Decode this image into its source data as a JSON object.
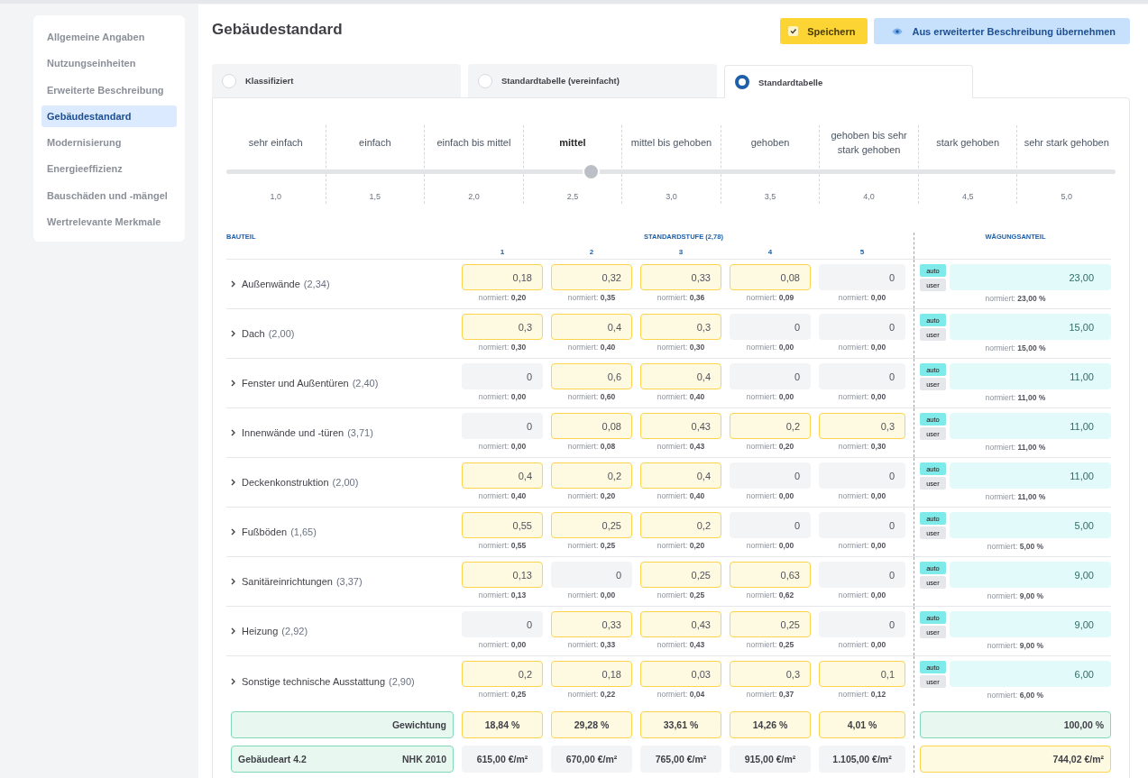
{
  "sidebar": {
    "items": [
      {
        "label": "Allgemeine Angaben",
        "selected": false
      },
      {
        "label": "Nutzungseinheiten",
        "selected": false
      },
      {
        "label": "Erweiterte Beschreibung",
        "selected": false
      },
      {
        "label": "Gebäudestandard",
        "selected": true
      },
      {
        "label": "Modernisierung",
        "selected": false
      },
      {
        "label": "Energieeffizienz",
        "selected": false
      },
      {
        "label": "Bauschäden und -mängel",
        "selected": false
      },
      {
        "label": "Wertrelevante Merkmale",
        "selected": false
      }
    ]
  },
  "title": "Gebäudestandard",
  "buttons": [
    {
      "kind": "save",
      "label": "Speichern"
    },
    {
      "kind": "import",
      "label": "Aus erweiterter Beschreibung übernehmen"
    }
  ],
  "tabs": [
    {
      "label": "Klassifiziert",
      "selected": false
    },
    {
      "label": "Standardtabelle (vereinfacht)",
      "selected": false
    },
    {
      "label": "Standardtabelle",
      "selected": true
    }
  ],
  "scale": {
    "level": 0.41,
    "steps": [
      {
        "label": "sehr einfach",
        "value": "1,0",
        "selected": false
      },
      {
        "label": "einfach",
        "value": "1,5",
        "selected": false
      },
      {
        "label": "einfach bis mittel",
        "value": "2,0",
        "selected": false
      },
      {
        "label": "mittel",
        "value": "2,5",
        "selected": true
      },
      {
        "label": "mittel bis gehoben",
        "value": "3,0",
        "selected": false
      },
      {
        "label": "gehoben",
        "value": "3,5",
        "selected": false
      },
      {
        "label": "gehoben bis sehr stark gehoben",
        "value": "4,0",
        "selected": false
      },
      {
        "label": "stark gehoben",
        "value": "4,5",
        "selected": false
      },
      {
        "label": "sehr stark gehoben",
        "value": "5,0",
        "selected": false
      }
    ]
  },
  "table": {
    "columns": {
      "component": "BAUTEIL",
      "standard": "STANDARDSTUFE (2,78)",
      "levels": [
        "1",
        "2",
        "3",
        "4",
        "5"
      ],
      "weight": "WÄGUNGSANTEIL"
    },
    "rows": [
      {
        "name": "Außenwände",
        "score": "(2,34)",
        "cells": [
          {
            "value": "0,18",
            "normed": "normiert: **0,20**",
            "filled": true
          },
          {
            "value": "0,32",
            "normed": "normiert: **0,35**",
            "filled": true
          },
          {
            "value": "0,33",
            "normed": "normiert: **0,36**",
            "filled": true
          },
          {
            "value": "0,08",
            "normed": "normiert: **0,09**",
            "filled": true
          },
          {
            "value": "0",
            "normed": "normiert: **0,00**",
            "filled": false
          }
        ],
        "modes": [
          {
            "label": "auto",
            "selected": true
          },
          {
            "label": "user",
            "selected": false
          }
        ],
        "weight": "23,00",
        "weight_normed": "normiert: **23,00 %**"
      },
      {
        "name": "Dach",
        "score": "(2,00)",
        "cells": [
          {
            "value": "0,3",
            "normed": "normiert: **0,30**",
            "filled": true
          },
          {
            "value": "0,4",
            "normed": "normiert: **0,40**",
            "filled": true
          },
          {
            "value": "0,3",
            "normed": "normiert: **0,30**",
            "filled": true
          },
          {
            "value": "0",
            "normed": "normiert: **0,00**",
            "filled": false
          },
          {
            "value": "0",
            "normed": "normiert: **0,00**",
            "filled": false
          }
        ],
        "modes": [
          {
            "label": "auto",
            "selected": true
          },
          {
            "label": "user",
            "selected": false
          }
        ],
        "weight": "15,00",
        "weight_normed": "normiert: **15,00 %**"
      },
      {
        "name": "Fenster und Außentüren",
        "score": "(2,40)",
        "cells": [
          {
            "value": "0",
            "normed": "normiert: **0,00**",
            "filled": false
          },
          {
            "value": "0,6",
            "normed": "normiert: **0,60**",
            "filled": true
          },
          {
            "value": "0,4",
            "normed": "normiert: **0,40**",
            "filled": true
          },
          {
            "value": "0",
            "normed": "normiert: **0,00**",
            "filled": false
          },
          {
            "value": "0",
            "normed": "normiert: **0,00**",
            "filled": false
          }
        ],
        "modes": [
          {
            "label": "auto",
            "selected": true
          },
          {
            "label": "user",
            "selected": false
          }
        ],
        "weight": "11,00",
        "weight_normed": "normiert: **11,00 %**"
      },
      {
        "name": "Innenwände und -türen",
        "score": "(3,71)",
        "cells": [
          {
            "value": "0",
            "normed": "normiert: **0,00**",
            "filled": false
          },
          {
            "value": "0,08",
            "normed": "normiert: **0,08**",
            "filled": true
          },
          {
            "value": "0,43",
            "normed": "normiert: **0,43**",
            "filled": true
          },
          {
            "value": "0,2",
            "normed": "normiert: **0,20**",
            "filled": true
          },
          {
            "value": "0,3",
            "normed": "normiert: **0,30**",
            "filled": true
          }
        ],
        "modes": [
          {
            "label": "auto",
            "selected": true
          },
          {
            "label": "user",
            "selected": false
          }
        ],
        "weight": "11,00",
        "weight_normed": "normiert: **11,00 %**"
      },
      {
        "name": "Deckenkonstruktion",
        "score": "(2,00)",
        "cells": [
          {
            "value": "0,4",
            "normed": "normiert: **0,40**",
            "filled": true
          },
          {
            "value": "0,2",
            "normed": "normiert: **0,20**",
            "filled": true
          },
          {
            "value": "0,4",
            "normed": "normiert: **0,40**",
            "filled": true
          },
          {
            "value": "0",
            "normed": "normiert: **0,00**",
            "filled": false
          },
          {
            "value": "0",
            "normed": "normiert: **0,00**",
            "filled": false
          }
        ],
        "modes": [
          {
            "label": "auto",
            "selected": true
          },
          {
            "label": "user",
            "selected": false
          }
        ],
        "weight": "11,00",
        "weight_normed": "normiert: **11,00 %**"
      },
      {
        "name": "Fußböden",
        "score": "(1,65)",
        "cells": [
          {
            "value": "0,55",
            "normed": "normiert: **0,55**",
            "filled": true
          },
          {
            "value": "0,25",
            "normed": "normiert: **0,25**",
            "filled": true
          },
          {
            "value": "0,2",
            "normed": "normiert: **0,20**",
            "filled": true
          },
          {
            "value": "0",
            "normed": "normiert: **0,00**",
            "filled": false
          },
          {
            "value": "0",
            "normed": "normiert: **0,00**",
            "filled": false
          }
        ],
        "modes": [
          {
            "label": "auto",
            "selected": true
          },
          {
            "label": "user",
            "selected": false
          }
        ],
        "weight": "5,00",
        "weight_normed": "normiert: **5,00 %**"
      },
      {
        "name": "Sanitäreinrichtungen",
        "score": "(3,37)",
        "cells": [
          {
            "value": "0,13",
            "normed": "normiert: **0,13**",
            "filled": true
          },
          {
            "value": "0",
            "normed": "normiert: **0,00**",
            "filled": false
          },
          {
            "value": "0,25",
            "normed": "normiert: **0,25**",
            "filled": true
          },
          {
            "value": "0,63",
            "normed": "normiert: **0,62**",
            "filled": true
          },
          {
            "value": "0",
            "normed": "normiert: **0,00**",
            "filled": false
          }
        ],
        "modes": [
          {
            "label": "auto",
            "selected": true
          },
          {
            "label": "user",
            "selected": false
          }
        ],
        "weight": "9,00",
        "weight_normed": "normiert: **9,00 %**"
      },
      {
        "name": "Heizung",
        "score": "(2,92)",
        "cells": [
          {
            "value": "0",
            "normed": "normiert: **0,00**",
            "filled": false
          },
          {
            "value": "0,33",
            "normed": "normiert: **0,33**",
            "filled": true
          },
          {
            "value": "0,43",
            "normed": "normiert: **0,43**",
            "filled": true
          },
          {
            "value": "0,25",
            "normed": "normiert: **0,25**",
            "filled": true
          },
          {
            "value": "0",
            "normed": "normiert: **0,00**",
            "filled": false
          }
        ],
        "modes": [
          {
            "label": "auto",
            "selected": true
          },
          {
            "label": "user",
            "selected": false
          }
        ],
        "weight": "9,00",
        "weight_normed": "normiert: **9,00 %**"
      },
      {
        "name": "Sonstige technische Ausstattung",
        "score": "(2,90)",
        "cells": [
          {
            "value": "0,2",
            "normed": "normiert: **0,25**",
            "filled": true
          },
          {
            "value": "0,18",
            "normed": "normiert: **0,22**",
            "filled": true
          },
          {
            "value": "0,03",
            "normed": "normiert: **0,04**",
            "filled": true
          },
          {
            "value": "0,3",
            "normed": "normiert: **0,37**",
            "filled": true
          },
          {
            "value": "0,1",
            "normed": "normiert: **0,12**",
            "filled": true
          }
        ],
        "modes": [
          {
            "label": "auto",
            "selected": true
          },
          {
            "label": "user",
            "selected": false
          }
        ],
        "weight": "6,00",
        "weight_normed": "normiert: **6,00 %**"
      }
    ],
    "weighting": {
      "label": "Gewichtung",
      "values": [
        "18,84 %",
        "29,28 %",
        "33,61 %",
        "14,26 %",
        "4,01 %"
      ],
      "total": "100,00 %"
    },
    "building": {
      "label": "Gebäudeart 4.2",
      "standard": "NHK 2010",
      "values": [
        "615,00 €/m²",
        "670,00 €/m²",
        "765,00 €/m²",
        "915,00 €/m²",
        "1.105,00 €/m²"
      ],
      "total": "744,02 €/m²"
    }
  }
}
